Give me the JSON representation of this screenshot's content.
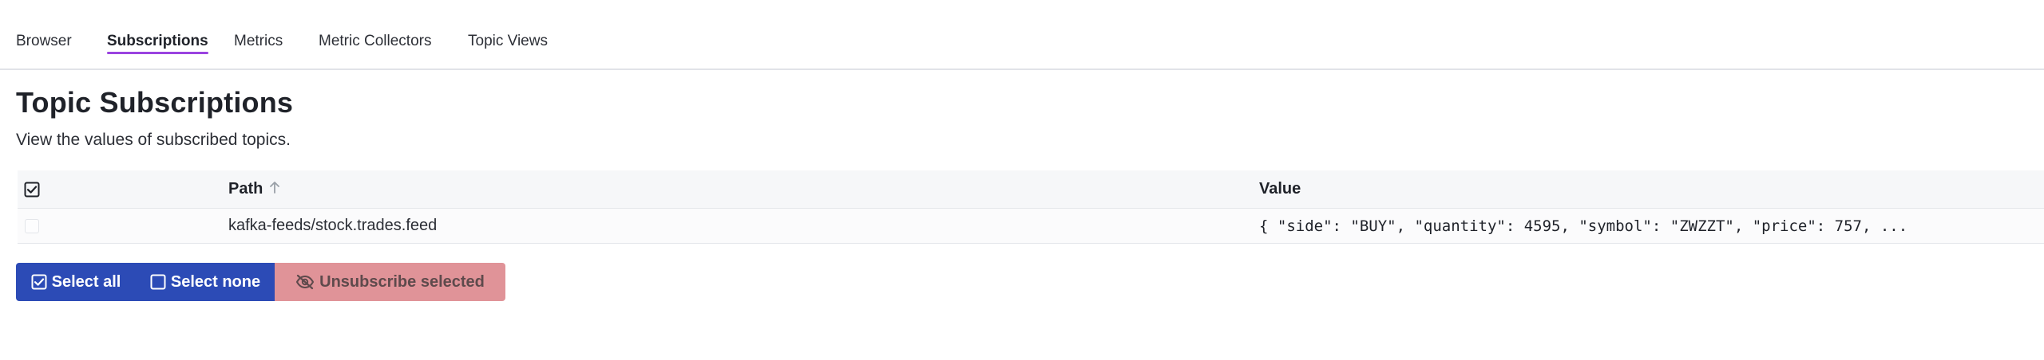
{
  "tabs": [
    {
      "label": "Browser",
      "active": false
    },
    {
      "label": "Subscriptions",
      "active": true
    },
    {
      "label": "Metrics",
      "active": false
    },
    {
      "label": "Metric Collectors",
      "active": false
    },
    {
      "label": "Topic Views",
      "active": false
    }
  ],
  "page": {
    "title": "Topic Subscriptions",
    "subtitle": "View the values of subscribed topics."
  },
  "table": {
    "columns": {
      "path": "Path",
      "value": "Value"
    },
    "sort": {
      "column": "path",
      "direction": "ascending",
      "icon": "arrow-up-icon"
    },
    "rows": [
      {
        "checked": false,
        "path": "kafka-feeds/stock.trades.feed",
        "value": "{ \"side\": \"BUY\", \"quantity\": 4595, \"symbol\": \"ZWZZT\", \"price\": 757, ..."
      }
    ]
  },
  "actions": {
    "select_all": "Select all",
    "select_none": "Select none",
    "unsubscribe_selected": "Unsubscribe selected"
  },
  "colors": {
    "accent_underline": "#9a43e0",
    "primary_button": "#2c4bb6",
    "danger_disabled_button": "#e09398"
  }
}
